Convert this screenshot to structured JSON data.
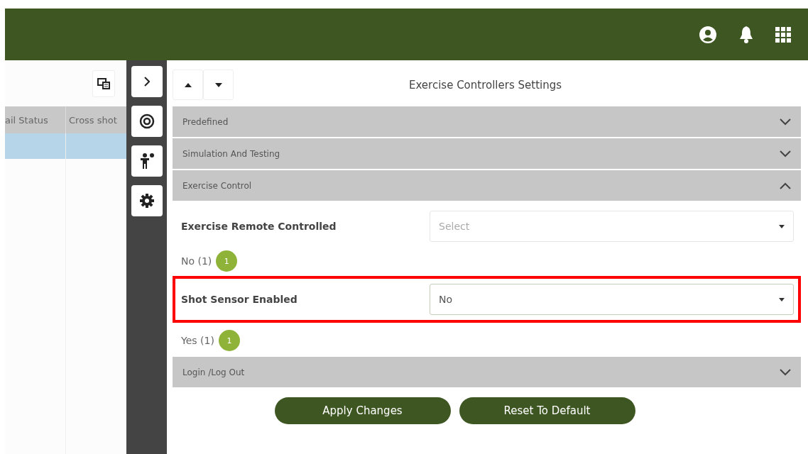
{
  "table": {
    "columns": [
      "ail Status",
      "Cross shot"
    ],
    "rows": [
      {
        "selected": true,
        "cells": [
          "",
          ""
        ]
      }
    ]
  },
  "panel": {
    "title": "Exercise Controllers Settings",
    "sections": [
      {
        "title": "Predefined",
        "expanded": false
      },
      {
        "title": "Simulation And Testing",
        "expanded": false
      },
      {
        "title": "Exercise Control",
        "expanded": true,
        "fields": [
          {
            "label": "Exercise Remote Controlled",
            "placeholder": "Select",
            "summary": "No (1)",
            "badge": "1",
            "highlighted": false
          },
          {
            "label": "Shot Sensor Enabled",
            "value": "No",
            "summary": "Yes (1)",
            "badge": "1",
            "highlighted": true
          }
        ]
      },
      {
        "title": "Login /Log Out",
        "expanded": false
      }
    ],
    "buttons": [
      "Apply Changes",
      "Reset To Default"
    ]
  }
}
